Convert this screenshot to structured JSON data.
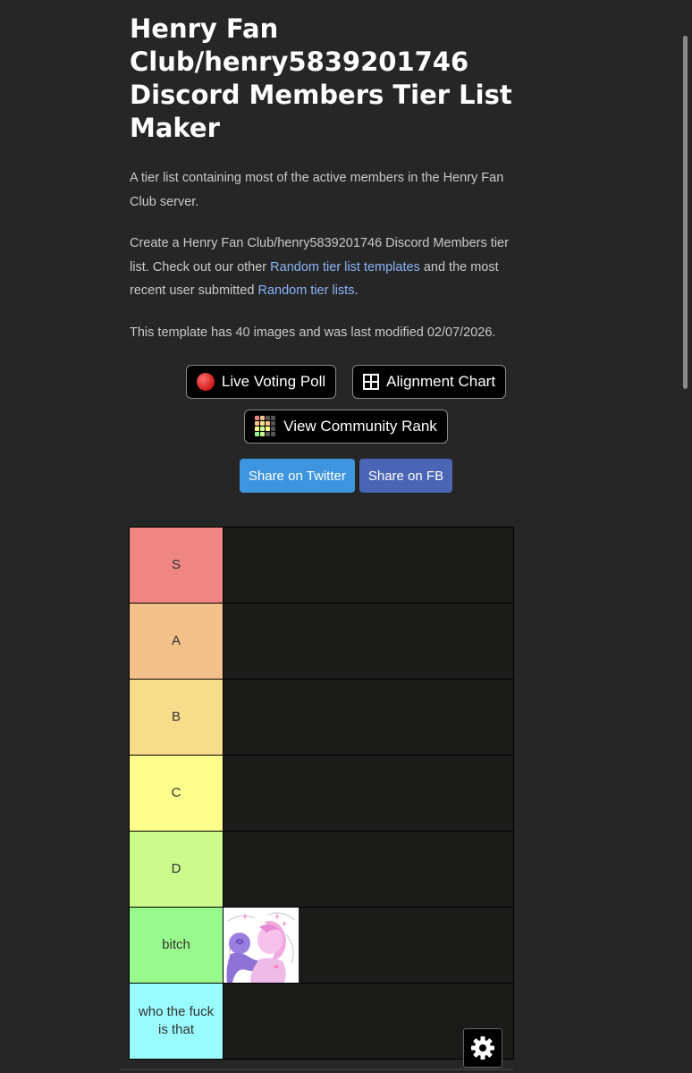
{
  "page": {
    "title": "Henry Fan Club/henry5839201746 Discord Members Tier List Maker",
    "description": "A tier list containing most of the active members in the Henry Fan Club server.",
    "create_text_1": "Create a Henry Fan Club/henry5839201746 Discord Members tier list. Check out our other ",
    "create_link_1": "Random tier list templates",
    "create_text_2": " and the most recent user submitted ",
    "create_link_2": "Random tier lists",
    "create_text_3": ".",
    "template_info": "This template has 40 images and was last modified 02/07/2026."
  },
  "buttons": {
    "live_voting": "Live Voting Poll",
    "alignment_chart": "Alignment Chart",
    "community_rank": "View Community Rank",
    "share_twitter": "Share on Twitter",
    "share_fb": "Share on FB"
  },
  "tiers": [
    {
      "label": "S",
      "color": "#f08682"
    },
    {
      "label": "A",
      "color": "#f4c08a"
    },
    {
      "label": "B",
      "color": "#f7dd8b"
    },
    {
      "label": "C",
      "color": "#fefe8c"
    },
    {
      "label": "D",
      "color": "#ccfb8c"
    },
    {
      "label": "bitch",
      "color": "#98f98c"
    },
    {
      "label": "who the fuck is that",
      "color": "#9afbfd"
    }
  ],
  "icons": {
    "live_voting": "red-circle-icon",
    "alignment_chart": "grid-icon",
    "community_rank": "rank-grid-icon",
    "settings": "gear-icon"
  }
}
